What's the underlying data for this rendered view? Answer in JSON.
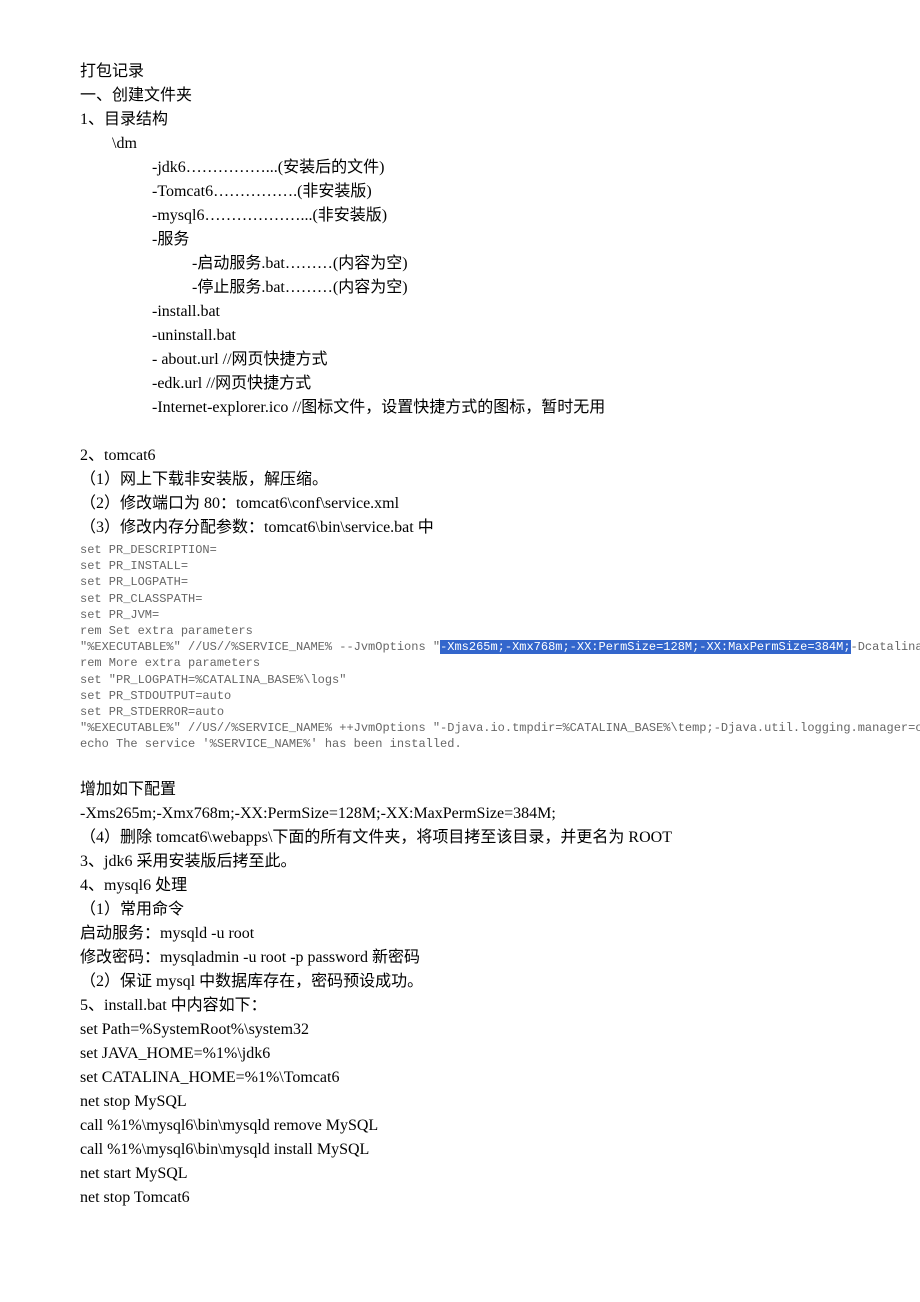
{
  "title": "打包记录",
  "s1": {
    "h": "一、创建文件夹",
    "p1": "1、目录结构",
    "tree": {
      "dm": "\\dm",
      "jdk": "-jdk6……………...(安装后的文件)",
      "tomcat": "-Tomcat6…………….(非安装版)",
      "mysql": "-mysql6………………...(非安装版)",
      "svc": "-服务",
      "start": "-启动服务.bat………(内容为空)",
      "stop": "-停止服务.bat………(内容为空)",
      "install": "-install.bat",
      "uninstall": "-uninstall.bat",
      "about": "- about.url     //网页快捷方式",
      "edk": "-edk.url   //网页快捷方式",
      "ie": "-Internet-explorer.ico     //图标文件，设置快捷方式的图标，暂时无用"
    }
  },
  "s2": {
    "h": "2、tomcat6",
    "p1": "（1）网上下载非安装版，解压缩。",
    "p2": "（2）修改端口为 80：tomcat6\\conf\\service.xml",
    "p3": "（3）修改内存分配参数：tomcat6\\bin\\service.bat 中",
    "code": {
      "l1": "set PR_DESCRIPTION=",
      "l2": "set PR_INSTALL=",
      "l3": "set PR_LOGPATH=",
      "l4": "set PR_CLASSPATH=",
      "l5": "set PR_JVM=",
      "l6": "rem Set extra parameters",
      "l7a": "\"%EXECUTABLE%\" //US//%SERVICE_NAME% --JvmOptions \"",
      "l7h": "-Xms265m;-Xmx768m;-XX:PermSize=128M;-XX:MaxPermSize=384M;",
      "l7b": "-Dcatalina.base",
      "l8": "rem More extra parameters",
      "l9": "set \"PR_LOGPATH=%CATALINA_BASE%\\logs\"",
      "l10": "set PR_STDOUTPUT=auto",
      "l11": "set PR_STDERROR=auto",
      "l12": "\"%EXECUTABLE%\" //US//%SERVICE_NAME% ++JvmOptions \"-Djava.io.tmpdir=%CATALINA_BASE%\\temp;-Djava.util.logging.manager=org.ap",
      "l13": "echo The service '%SERVICE_NAME%' has been installed."
    },
    "add": "增加如下配置",
    "addline": "-Xms265m;-Xmx768m;-XX:PermSize=128M;-XX:MaxPermSize=384M;",
    "p4": "（4）删除 tomcat6\\webapps\\下面的所有文件夹，将项目拷至该目录，并更名为 ROOT"
  },
  "s3": "3、jdk6 采用安装版后拷至此。",
  "s4": {
    "h": "4、mysql6 处理",
    "p1": "（1）常用命令",
    "p2": "启动服务：mysqld -u root",
    "p3": "修改密码：mysqladmin -u root -p password  新密码",
    "p4": "（2）保证 mysql 中数据库存在，密码预设成功。"
  },
  "s5": {
    "h": "5、install.bat 中内容如下：",
    "l1": "set Path=%SystemRoot%\\system32",
    "l2": "set JAVA_HOME=%1%\\jdk6",
    "l3": "set CATALINA_HOME=%1%\\Tomcat6",
    "l4": "net stop MySQL",
    "l5": "call %1%\\mysql6\\bin\\mysqld remove MySQL",
    "l6": "call %1%\\mysql6\\bin\\mysqld install MySQL",
    "l7": "net start MySQL",
    "l8": "net stop Tomcat6"
  }
}
